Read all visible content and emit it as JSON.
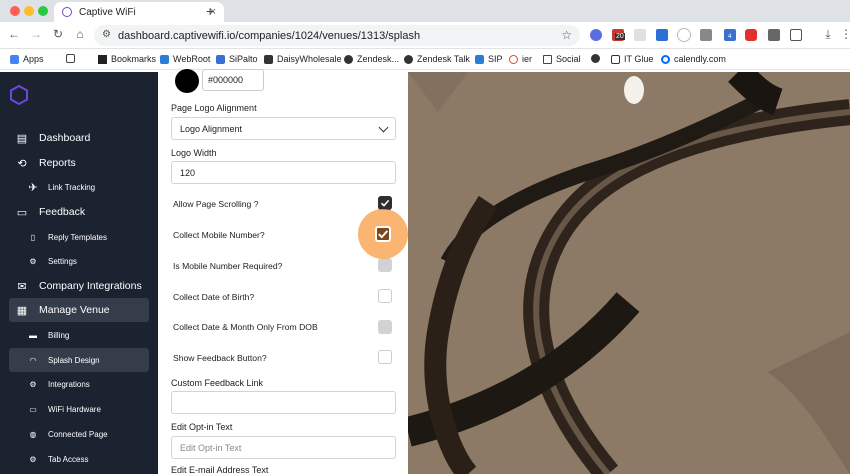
{
  "browser": {
    "tab_title": "Captive WiFi",
    "url": "dashboard.captivewifi.io/companies/1024/venues/1313/splash",
    "badge_20": "20",
    "badge_4": "4",
    "bookmarks": [
      "Apps",
      "Bookmarks",
      "WebRoot",
      "SiPalto",
      "DaisyWholesale",
      "Zendesk...",
      "Zendesk Talk",
      "SIP",
      "ier",
      "Social",
      "IT Glue",
      "calendly.com"
    ]
  },
  "sidebar": {
    "items": [
      {
        "label": "Dashboard",
        "icon": "dashboard-icon"
      },
      {
        "label": "Reports",
        "icon": "refresh-icon"
      },
      {
        "label": "Link Tracking",
        "icon": "rocket-icon"
      },
      {
        "label": "Feedback",
        "icon": "chat-icon"
      },
      {
        "label": "Reply Templates",
        "icon": "document-icon"
      },
      {
        "label": "Settings",
        "icon": "gear-icon"
      },
      {
        "label": "Company Integrations",
        "icon": "mail-icon"
      },
      {
        "label": "Manage Venue",
        "icon": "store-icon"
      },
      {
        "label": "Billing",
        "icon": "card-icon"
      },
      {
        "label": "Splash Design",
        "icon": "wifi-icon"
      },
      {
        "label": "Integrations",
        "icon": "gear-icon"
      },
      {
        "label": "WiFi Hardware",
        "icon": "router-icon"
      },
      {
        "label": "Connected Page",
        "icon": "globe-icon"
      },
      {
        "label": "Tab Access",
        "icon": "gear-icon"
      }
    ]
  },
  "form": {
    "color_value": "#000000",
    "logo_alignment_label": "Page Logo Alignment",
    "logo_alignment_value": "Logo Alignment",
    "logo_width_label": "Logo Width",
    "logo_width_value": "120",
    "allow_scrolling": "Allow Page Scrolling ?",
    "collect_mobile": "Collect Mobile Number?",
    "mobile_required": "Is Mobile Number Required?",
    "collect_dob": "Collect Date of Birth?",
    "collect_date_month": "Collect Date & Month Only From DOB",
    "show_feedback": "Show Feedback Button?",
    "custom_feedback_label": "Custom Feedback Link",
    "custom_feedback_value": "",
    "optin_label": "Edit Opt-in Text",
    "optin_placeholder": "Edit Opt-in Text",
    "email_text_label": "Edit E-mail Address Text"
  },
  "colors": {
    "sidebar_bg": "#1b2230",
    "sidebar_active": "#353c4a",
    "highlight": "#f8a858",
    "brand": "#6c47e0"
  }
}
